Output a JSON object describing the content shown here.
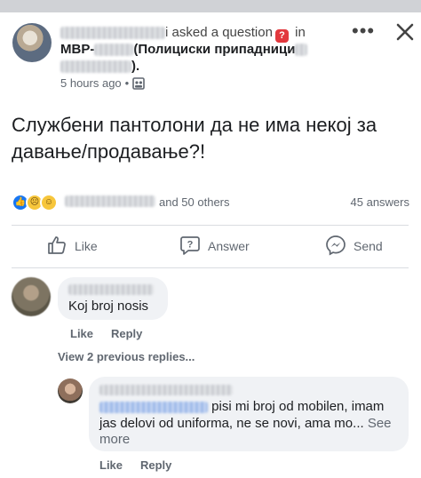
{
  "post": {
    "asked_text": "asked a question",
    "in_text": "in",
    "question_badge": "?",
    "group_prefix": "MBP-",
    "group_name_visible": "(Полициски припадници",
    "group_suffix": ").",
    "time": "5 hours ago",
    "dot": "•",
    "body": "Службени пантолони да не има некој за давање/продавање?!",
    "more_icon": "•••",
    "reactions": {
      "icons": [
        "like-icon",
        "sad-icon",
        "haha-icon"
      ],
      "others_text": "and 50 others",
      "answers_text": "45 answers"
    }
  },
  "actions": {
    "like": "Like",
    "answer": "Answer",
    "send": "Send"
  },
  "comments": [
    {
      "text": "Koj broj nosis",
      "like": "Like",
      "reply": "Reply"
    }
  ],
  "view_replies": "View 2 previous replies...",
  "reply": {
    "text_line1": " pisi mi broj od mobilen, imam",
    "text_line2": "jas delovi od uniforma, ne se novi, ama mo...",
    "see_more": " See",
    "see_more_2": "more",
    "like": "Like",
    "reply": "Reply"
  },
  "colors": {
    "accent": "#1877f2",
    "badge_red": "#e2383d",
    "muted": "#606770",
    "bubble": "#f0f2f5"
  }
}
